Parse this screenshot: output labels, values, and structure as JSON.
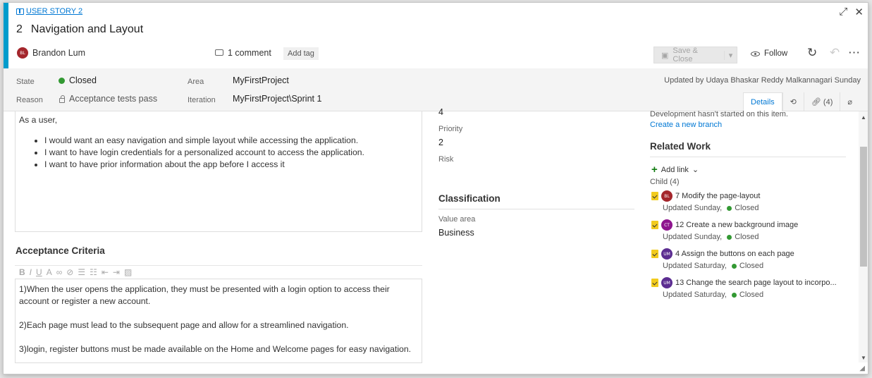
{
  "work_item": {
    "type_label": "USER STORY 2",
    "id": "2",
    "title": "Navigation and Layout",
    "author": "Brandon Lum",
    "author_initials": "BL",
    "comments": "1 comment",
    "add_tag": "Add tag"
  },
  "toolbar": {
    "save_label": "Save & Close",
    "follow_label": "Follow",
    "colors": {
      "accent": "#009ccc",
      "link": "#0078d4",
      "closed": "#339933"
    }
  },
  "fields": {
    "state_label": "State",
    "state_value": "Closed",
    "reason_label": "Reason",
    "reason_value": "Acceptance tests pass",
    "area_label": "Area",
    "area_value": "MyFirstProject",
    "iteration_label": "Iteration",
    "iteration_value": "MyFirstProject\\Sprint 1",
    "updated_by": "Updated by Udaya Bhaskar Reddy Malkannagari Sunday"
  },
  "tabs": {
    "details": "Details",
    "links": "(4)"
  },
  "description": {
    "intro": "As a user,",
    "bullets": [
      "I would want an easy navigation and simple layout while accessing the application.",
      "I want to have login credentials for a personalized account to access the application.",
      "I want to have prior information about the app before I access it"
    ]
  },
  "acceptance": {
    "heading": "Acceptance Criteria",
    "items": [
      "1)When the user opens the application, they must be presented with a login option to access their account or register a new account.",
      "2)Each page must lead to the subsequent page and allow for a streamlined navigation.",
      "3)login, register buttons must be made available on the Home and Welcome pages for easy navigation."
    ]
  },
  "planning": {
    "partial_value": "4",
    "priority_label": "Priority",
    "priority_value": "2",
    "risk_label": "Risk",
    "classification_heading": "Classification",
    "value_area_label": "Value area",
    "value_area_value": "Business"
  },
  "development": {
    "status": "Development hasn't started on this item.",
    "create_branch": "Create a new branch"
  },
  "related_work": {
    "heading": "Related Work",
    "add_link": "Add link",
    "child_label": "Child (4)",
    "items": [
      {
        "initials": "BL",
        "color": "#a4262c",
        "title": "7 Modify the page-layout",
        "updated": "Updated Sunday,",
        "state": "Closed"
      },
      {
        "initials": "CT",
        "color": "#8e148e",
        "title": "12 Create a new background image",
        "updated": "Updated Sunday,",
        "state": "Closed"
      },
      {
        "initials": "UM",
        "color": "#5c2d91",
        "title": "4 Assign the buttons on each page",
        "updated": "Updated Saturday,",
        "state": "Closed"
      },
      {
        "initials": "UM",
        "color": "#5c2d91",
        "title": "13 Change the search page layout to incorpo...",
        "updated": "Updated Saturday,",
        "state": "Closed"
      }
    ]
  }
}
